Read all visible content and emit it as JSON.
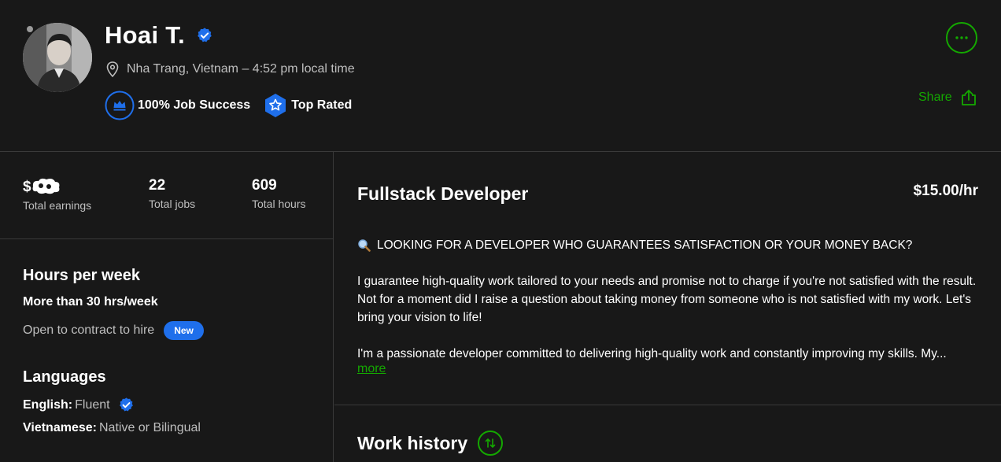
{
  "profile": {
    "name": "Hoai T.",
    "location": "Nha Trang, Vietnam – 4:52 pm local time",
    "badges": {
      "job_success": "100% Job Success",
      "top_rated": "Top Rated"
    },
    "share_label": "Share",
    "colors": {
      "accent": "#14a800",
      "verified": "#1f6feb",
      "background": "#181818",
      "divider": "#3a3a3a"
    }
  },
  "stats": [
    {
      "value": "$",
      "label": "Total earnings"
    },
    {
      "value": "22",
      "label": "Total jobs"
    },
    {
      "value": "609",
      "label": "Total hours"
    }
  ],
  "sidebar": {
    "hours_title": "Hours per week",
    "hours_value": "More than 30 hrs/week",
    "contract_text": "Open to contract to hire",
    "new_badge": "New",
    "languages_title": "Languages",
    "languages": [
      {
        "name": "English:",
        "level": "Fluent",
        "verified": true
      },
      {
        "name": "Vietnamese:",
        "level": "Native or Bilingual",
        "verified": false
      }
    ]
  },
  "main": {
    "title": "Fullstack Developer",
    "rate": "$15.00/hr",
    "description": [
      "LOOKING FOR A DEVELOPER WHO GUARANTEES SATISFACTION OR YOUR MONEY BACK?",
      "I guarantee high-quality work tailored to your needs and promise not to charge if you're not satisfied with the result. Not for a moment did I raise a question about taking money from someone who is not satisfied with my work. Let's bring your vision to life!",
      "I'm a passionate developer committed to delivering high-quality work and constantly improving my skills. My..."
    ],
    "more_label": "more",
    "work_history_title": "Work history"
  },
  "icons": {
    "verified": "verified-badge-icon",
    "location": "location-pin-icon",
    "job_success": "crown-icon",
    "top_rated": "star-badge-icon",
    "more": "ellipsis-icon",
    "share": "share-upload-icon",
    "search": "magnifier-icon",
    "sort": "sort-arrows-icon"
  }
}
